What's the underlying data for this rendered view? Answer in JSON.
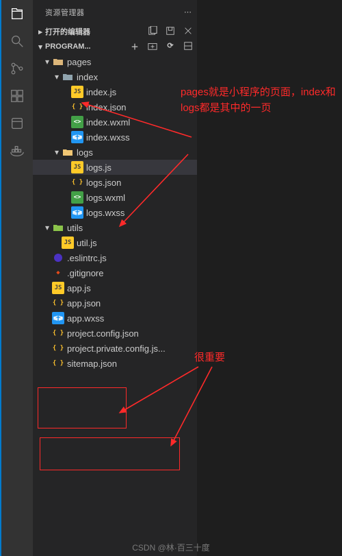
{
  "activity_bar": {
    "items": [
      "files",
      "search",
      "scm",
      "extensions",
      "run",
      "docker"
    ]
  },
  "sidebar": {
    "title": "资源管理器",
    "sections": {
      "open_editors": "打开的编辑器",
      "project": "PROGRAM..."
    }
  },
  "tree": {
    "pages": "pages",
    "index": "index",
    "index_js": "index.js",
    "index_json": "index.json",
    "index_wxml": "index.wxml",
    "index_wxss": "index.wxss",
    "logs": "logs",
    "logs_js": "logs.js",
    "logs_json": "logs.json",
    "logs_wxml": "logs.wxml",
    "logs_wxss": "logs.wxss",
    "utils": "utils",
    "util_js": "util.js",
    "eslintrc": ".eslintrc.js",
    "gitignore": ".gitignore",
    "app_js": "app.js",
    "app_json": "app.json",
    "app_wxss": "app.wxss",
    "project_config": "project.config.json",
    "project_private": "project.private.config.js...",
    "sitemap": "sitemap.json"
  },
  "annotations": {
    "pages_note": "pages就是小程序的页面，index和logs都是其中的一页",
    "important": "很重要"
  },
  "footer": "CSDN @林·百三十度"
}
